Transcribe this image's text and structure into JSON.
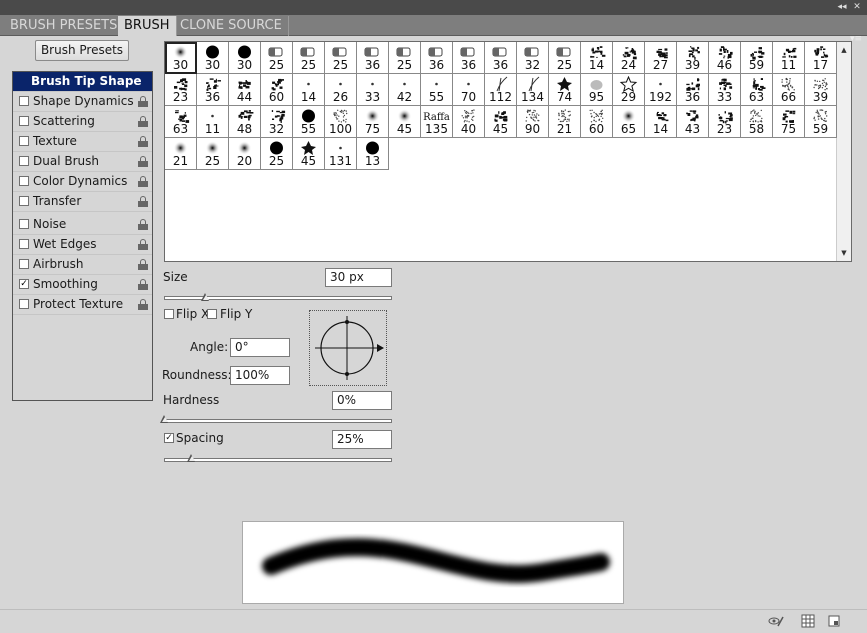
{
  "window": {
    "controls": {
      "collapse": "◂◂",
      "close": "✕"
    },
    "menu_icon": "panel-menu-icon"
  },
  "tabs": [
    "BRUSH PRESETS",
    "BRUSH",
    "CLONE SOURCE"
  ],
  "active_tab": "BRUSH",
  "brush_presets_button": "Brush Presets",
  "sidebar": [
    {
      "label": "Brush Tip Shape",
      "selected": true,
      "checkbox": false,
      "lock": false
    },
    {
      "label": "Shape Dynamics",
      "checked": false,
      "lock": true
    },
    {
      "label": "Scattering",
      "checked": false,
      "lock": true
    },
    {
      "label": "Texture",
      "checked": false,
      "lock": true
    },
    {
      "label": "Dual Brush",
      "checked": false,
      "lock": true
    },
    {
      "label": "Color Dynamics",
      "checked": false,
      "lock": true
    },
    {
      "label": "Transfer",
      "checked": false,
      "lock": true
    },
    {
      "label": "Noise",
      "checked": false,
      "lock": true
    },
    {
      "label": "Wet Edges",
      "checked": false,
      "lock": true
    },
    {
      "label": "Airbrush",
      "checked": false,
      "lock": true
    },
    {
      "label": "Smoothing",
      "checked": true,
      "lock": true
    },
    {
      "label": "Protect Texture",
      "checked": false,
      "lock": true
    }
  ],
  "brushes": [
    {
      "size": "30",
      "icon": "soft-round"
    },
    {
      "size": "30",
      "icon": "hard-round"
    },
    {
      "size": "30",
      "icon": "hard-round"
    },
    {
      "size": "25",
      "icon": "chisel"
    },
    {
      "size": "25",
      "icon": "chisel"
    },
    {
      "size": "25",
      "icon": "chisel"
    },
    {
      "size": "36",
      "icon": "chisel"
    },
    {
      "size": "25",
      "icon": "chisel"
    },
    {
      "size": "36",
      "icon": "chisel"
    },
    {
      "size": "36",
      "icon": "chisel"
    },
    {
      "size": "36",
      "icon": "chisel"
    },
    {
      "size": "32",
      "icon": "chisel"
    },
    {
      "size": "25",
      "icon": "chisel"
    },
    {
      "size": "14",
      "icon": "splatter"
    },
    {
      "size": "24",
      "icon": "splatter"
    },
    {
      "size": "27",
      "icon": "splatter"
    },
    {
      "size": "39",
      "icon": "splatter"
    },
    {
      "size": "46",
      "icon": "splatter"
    },
    {
      "size": "59",
      "icon": "splatter"
    },
    {
      "size": "11",
      "icon": "splatter"
    },
    {
      "size": "17",
      "icon": "splatter"
    },
    {
      "size": "23",
      "icon": "splatter"
    },
    {
      "size": "36",
      "icon": "splatter"
    },
    {
      "size": "44",
      "icon": "splatter"
    },
    {
      "size": "60",
      "icon": "splatter"
    },
    {
      "size": "14",
      "icon": "dot"
    },
    {
      "size": "26",
      "icon": "dot"
    },
    {
      "size": "33",
      "icon": "dot"
    },
    {
      "size": "42",
      "icon": "dot"
    },
    {
      "size": "55",
      "icon": "dot"
    },
    {
      "size": "70",
      "icon": "dot"
    },
    {
      "size": "112",
      "icon": "grass"
    },
    {
      "size": "134",
      "icon": "grass"
    },
    {
      "size": "74",
      "icon": "leaf"
    },
    {
      "size": "95",
      "icon": "blob"
    },
    {
      "size": "29",
      "icon": "star"
    },
    {
      "size": "192",
      "icon": "dot"
    },
    {
      "size": "36",
      "icon": "splatter"
    },
    {
      "size": "33",
      "icon": "splatter"
    },
    {
      "size": "63",
      "icon": "splatter"
    },
    {
      "size": "66",
      "icon": "texture"
    },
    {
      "size": "39",
      "icon": "texture"
    },
    {
      "size": "63",
      "icon": "splatter"
    },
    {
      "size": "11",
      "icon": "dot"
    },
    {
      "size": "48",
      "icon": "splatter"
    },
    {
      "size": "32",
      "icon": "splatter"
    },
    {
      "size": "55",
      "icon": "hard-round"
    },
    {
      "size": "100",
      "icon": "texture"
    },
    {
      "size": "75",
      "icon": "soft-round"
    },
    {
      "size": "45",
      "icon": "soft-round"
    },
    {
      "size": "135",
      "icon": "text"
    },
    {
      "size": "40",
      "icon": "texture"
    },
    {
      "size": "45",
      "icon": "splatter"
    },
    {
      "size": "90",
      "icon": "texture"
    },
    {
      "size": "21",
      "icon": "texture"
    },
    {
      "size": "60",
      "icon": "texture"
    },
    {
      "size": "65",
      "icon": "soft-round"
    },
    {
      "size": "14",
      "icon": "splatter"
    },
    {
      "size": "43",
      "icon": "splatter"
    },
    {
      "size": "23",
      "icon": "splatter"
    },
    {
      "size": "58",
      "icon": "texture"
    },
    {
      "size": "75",
      "icon": "splatter"
    },
    {
      "size": "59",
      "icon": "texture"
    },
    {
      "size": "21",
      "icon": "soft-round"
    },
    {
      "size": "25",
      "icon": "soft-round"
    },
    {
      "size": "20",
      "icon": "soft-round"
    },
    {
      "size": "25",
      "icon": "hard-round"
    },
    {
      "size": "45",
      "icon": "leaf"
    },
    {
      "size": "131",
      "icon": "dot"
    },
    {
      "size": "13",
      "icon": "hard-round"
    }
  ],
  "brush_texture_text": "Raffa",
  "settings": {
    "size_label": "Size",
    "size_value": "30 px",
    "size_fraction": 0.18,
    "flip_x": "Flip X",
    "flip_y": "Flip Y",
    "angle_label": "Angle:",
    "angle_value": "0°",
    "roundness_label": "Roundness:",
    "roundness_value": "100%",
    "hardness_label": "Hardness",
    "hardness_value": "0%",
    "hardness_fraction": 0.0,
    "spacing_label": "Spacing",
    "spacing_checked": true,
    "spacing_value": "25%",
    "spacing_fraction": 0.12
  },
  "bottom_icons": [
    "eye-brush-icon",
    "grid-icon",
    "new-preset-icon"
  ]
}
